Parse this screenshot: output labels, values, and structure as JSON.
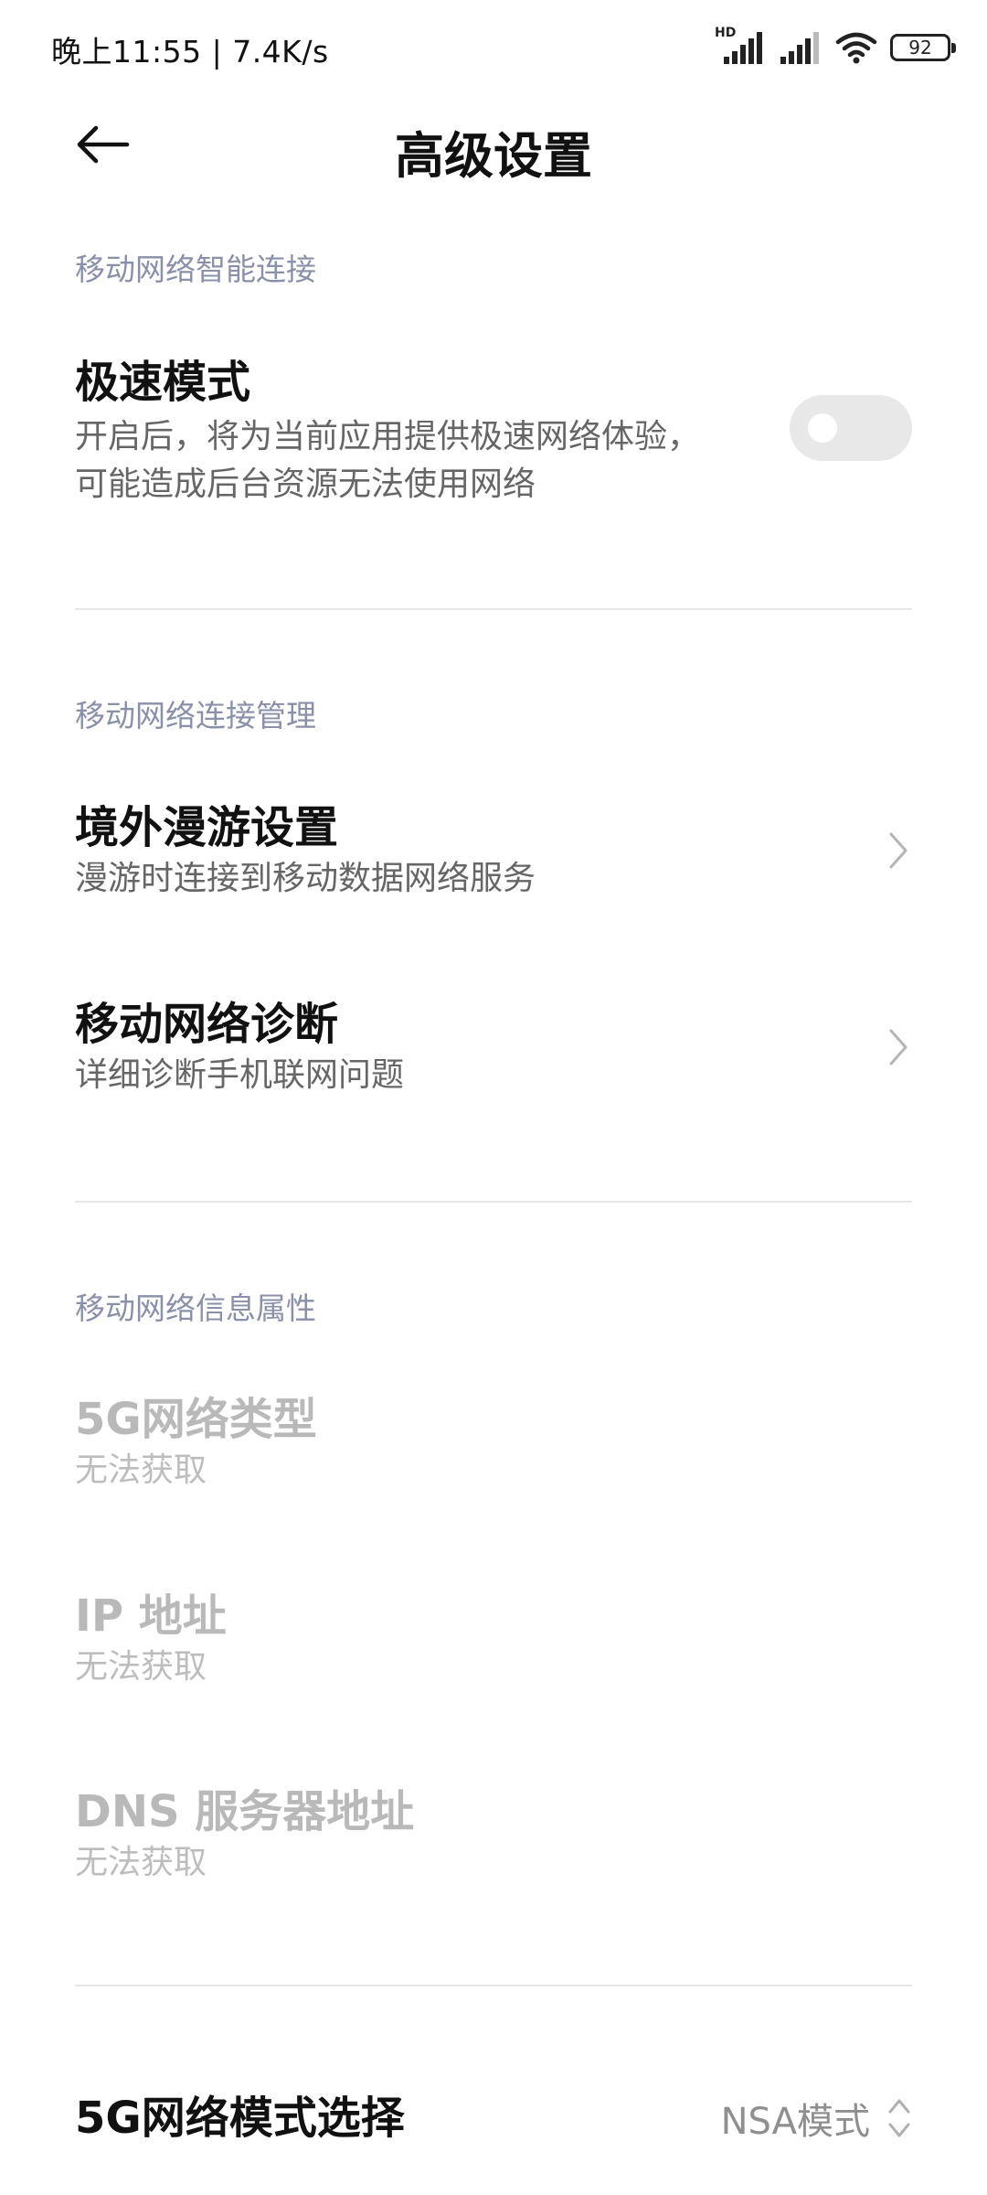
{
  "status_bar": {
    "left_text": "晚上11:55 | 7.4K/s",
    "hd_label": "HD",
    "battery_level": "92"
  },
  "header": {
    "title": "高级设置"
  },
  "sections": {
    "smart_connect": {
      "title": "移动网络智能连接",
      "speed_mode": {
        "title": "极速模式",
        "subtitle_line1": "开启后，将为当前应用提供极速网络体验，",
        "subtitle_line2": "可能造成后台资源无法使用网络",
        "enabled": false
      }
    },
    "connection_management": {
      "title": "移动网络连接管理",
      "roaming": {
        "title": "境外漫游设置",
        "subtitle": "漫游时连接到移动数据网络服务"
      },
      "diagnosis": {
        "title": "移动网络诊断",
        "subtitle": "详细诊断手机联网问题"
      }
    },
    "info": {
      "title": "移动网络信息属性",
      "network_type": {
        "title": "5G网络类型",
        "value": "无法获取"
      },
      "ip_address": {
        "title": "IP 地址",
        "value": "无法获取"
      },
      "dns": {
        "title": "DNS 服务器地址",
        "value": "无法获取"
      }
    },
    "mode_select": {
      "title": "5G网络模式选择",
      "value": "NSA模式"
    }
  },
  "colors": {
    "section_title": "#8a90a8",
    "toggle_off": "#e8e8e8",
    "disabled_text": "#b9b9b9"
  }
}
